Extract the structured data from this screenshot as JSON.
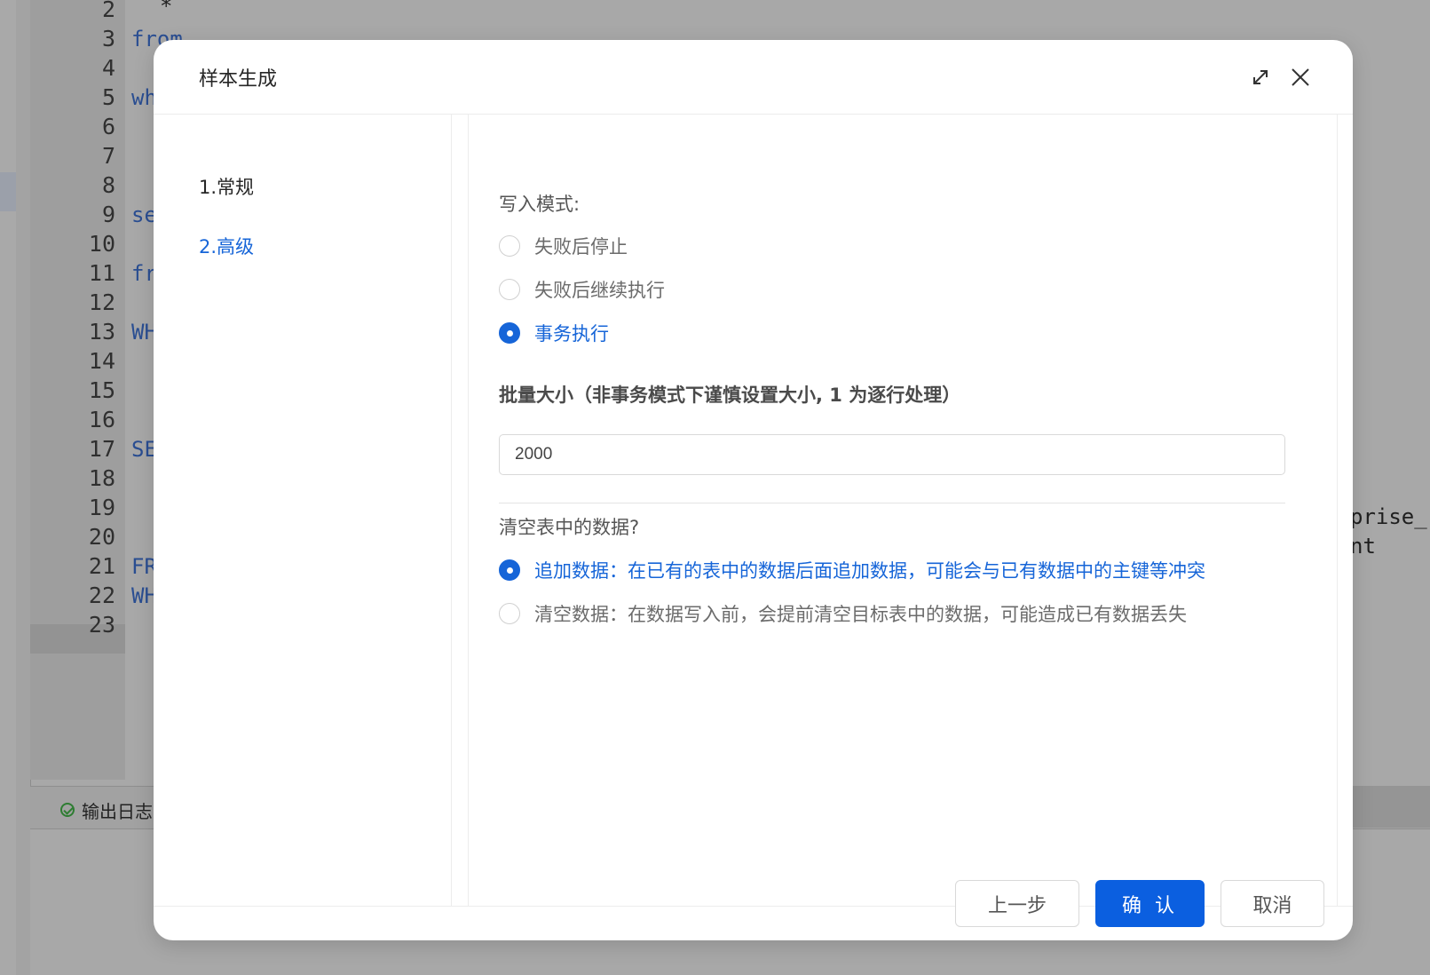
{
  "editor": {
    "line_numbers": [
      "2",
      "3",
      "4",
      "5",
      "6",
      "7",
      "8",
      "9",
      "10",
      "11",
      "12",
      "13",
      "14",
      "15",
      "16",
      "17",
      "18",
      "19",
      "20",
      "21",
      "22",
      "23"
    ],
    "code_fragments": {
      "l2": "*",
      "l3": "from",
      "l5": "wh",
      "l9": "se",
      "l11": "fr",
      "l13": "WH",
      "l17": "SE",
      "l21": "FR",
      "l22": "WH"
    },
    "right_fragments": [
      "prise_",
      "nt"
    ],
    "log_tab_label": "输出日志"
  },
  "dialog": {
    "title": "样本生成",
    "steps": [
      "1.常规",
      "2.高级"
    ],
    "write_mode": {
      "label": "写入模式:",
      "options": [
        "失败后停止",
        "失败后继续执行",
        "事务执行"
      ],
      "selected": "事务执行"
    },
    "batch_size": {
      "label": "批量大小（非事务模式下谨慎设置大小, 1 为逐行处理）",
      "value": "2000"
    },
    "clear_table": {
      "label": "清空表中的数据?",
      "options": [
        "追加数据：在已有的表中的数据后面追加数据，可能会与已有数据中的主键等冲突",
        "清空数据：在数据写入前，会提前清空目标表中的数据，可能造成已有数据丢失"
      ],
      "selected_index": 0
    },
    "buttons": {
      "prev": "上一步",
      "confirm": "确 认",
      "cancel": "取消"
    },
    "colors": {
      "accent": "#1665d8",
      "primary_button": "#0b5fe0"
    }
  }
}
